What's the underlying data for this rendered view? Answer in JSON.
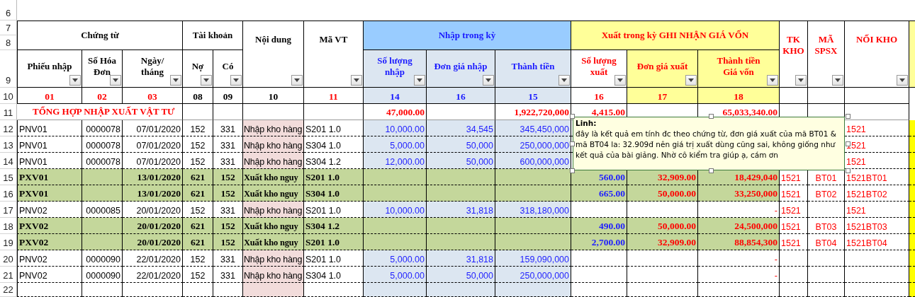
{
  "row_numbers": [
    "6",
    "7",
    "8",
    "9",
    "10",
    "11",
    "12",
    "13",
    "14",
    "15",
    "16",
    "17",
    "18",
    "19",
    "20",
    "21",
    "22"
  ],
  "header": [
    {
      "kind": "group",
      "label": "Chứng từ",
      "color": "#000000",
      "columns": [
        {
          "label": "Phiếu nhập",
          "color": "#000000",
          "filter_button": true,
          "code": {
            "text": "01",
            "color": "#ff0000"
          }
        },
        {
          "label": "Số  Hóa\nĐơn",
          "color": "#000000",
          "filter_button": true,
          "code": {
            "text": "02",
            "color": "#ff0000"
          }
        },
        {
          "label": "Ngày/\ntháng",
          "color": "#000000",
          "filter_button": true,
          "code": {
            "text": "03",
            "color": "#ff0000"
          }
        }
      ]
    },
    {
      "kind": "group",
      "label": "Tài khoản",
      "color": "#000000",
      "columns": [
        {
          "label": "Nợ",
          "color": "#000000",
          "filter_button": true,
          "code": {
            "text": "08",
            "color": "#000000"
          }
        },
        {
          "label": "Có",
          "color": "#000000",
          "filter_button": true,
          "code": {
            "text": "09",
            "color": "#000000"
          }
        }
      ]
    },
    {
      "kind": "single",
      "label": "Nội dung",
      "color": "#000000",
      "filter_button": true,
      "code": {
        "text": "10",
        "color": "#000000"
      }
    },
    {
      "kind": "single",
      "label": "Mã VT",
      "color": "#000000",
      "filter_button": true,
      "code": {
        "text": "11",
        "color": "#ff0000"
      }
    },
    {
      "kind": "inflow",
      "label": "Nhập trong kỳ",
      "color": "#1a1aff",
      "columns": [
        {
          "label": "Số lượng\nnhập",
          "color": "#1a1aff",
          "filter_button": true,
          "code": {
            "text": "14",
            "color": "#1a1aff"
          }
        },
        {
          "label": "Đơn giá nhập",
          "color": "#1a1aff",
          "filter_button": true,
          "code": {
            "text": "16",
            "color": "#1a1aff"
          }
        },
        {
          "label": "Thành tiền",
          "color": "#1a1aff",
          "filter_button": true,
          "code": {
            "text": "15",
            "color": "#1a1aff"
          }
        }
      ]
    },
    {
      "kind": "outflow",
      "label": "Xuất trong kỳ GHI NHẬN GIÁ VỐN",
      "color": "#ff0000",
      "columns": [
        {
          "label": "Số lượng\nxuất",
          "color": "#ff0000",
          "filter_button": true,
          "code": {
            "text": "16",
            "color": "#ff0000"
          }
        },
        {
          "label": "Đơn giá xuất",
          "color": "#ff0000",
          "filter_button": true,
          "code": {
            "text": "17",
            "color": "#ff0000"
          }
        },
        {
          "label": "Thành tiền\nGiá vốn",
          "color": "#ff0000",
          "filter_button": true,
          "code": {
            "text": "18",
            "color": "#ff0000"
          }
        }
      ]
    },
    {
      "kind": "single",
      "label": "TK\nKHO",
      "color": "#ff0000",
      "filter_button": true
    },
    {
      "kind": "single",
      "label": "MÃ\nSPSX",
      "color": "#ff0000",
      "filter_button": true
    },
    {
      "kind": "single",
      "label": "NỐI KHO",
      "color": "#ff0000",
      "filter_button": true
    }
  ],
  "rows": [
    {
      "kind": "total",
      "title": "TỔNG HỢP NHẬP XUẤT VẬT TƯ",
      "cells": {
        "sl_nhap": "47,000.00",
        "tt_nhap": "1,922,720,000",
        "sl_xuat": "4,415.00",
        "tt_xuat": "65,033,340.00"
      }
    },
    {
      "kind": "entry",
      "cells": {
        "phieu": "PNV01",
        "so_hd": "0000078",
        "ngay": "07/01/2020",
        "no": "152",
        "co": "331",
        "noi_dung": "Nhập kho hàng",
        "ma_vt": "S201 1.0",
        "sl_nhap": "10,000.00",
        "dg_nhap": "34,545",
        "tt_nhap": "345,450,000",
        "noi_kho": "1521"
      }
    },
    {
      "kind": "entry",
      "cells": {
        "phieu": "PNV01",
        "so_hd": "0000078",
        "ngay": "07/01/2020",
        "no": "152",
        "co": "331",
        "noi_dung": "Nhập kho hàng",
        "ma_vt": "S304 1.0",
        "sl_nhap": "5,000.00",
        "dg_nhap": "50,000",
        "tt_nhap": "250,000,000",
        "noi_kho": "1521"
      }
    },
    {
      "kind": "entry",
      "cells": {
        "phieu": "PNV01",
        "so_hd": "0000078",
        "ngay": "07/01/2020",
        "no": "152",
        "co": "331",
        "noi_dung": "Nhập kho hàng",
        "ma_vt": "S304 1.2",
        "sl_nhap": "12,000.00",
        "dg_nhap": "50,000",
        "tt_nhap": "600,000,000",
        "noi_kho": "1521"
      }
    },
    {
      "kind": "issue",
      "cells": {
        "phieu": "PXV01",
        "ngay": "13/01/2020",
        "no": "621",
        "co": "152",
        "noi_dung": "Xuất kho nguy",
        "ma_vt": "S201 1.0",
        "sl_xuat": "560.00",
        "dg_xuat": "32,909.00",
        "tt_xuat": "18,429,040",
        "tk_kho": "1521",
        "ma_spsx": "BT01",
        "noi_kho": "1521BT01"
      }
    },
    {
      "kind": "issue",
      "cells": {
        "phieu": "PXV01",
        "ngay": "13/01/2020",
        "no": "621",
        "co": "152",
        "noi_dung": "Xuất kho nguy",
        "ma_vt": "S304 1.0",
        "sl_xuat": "665.00",
        "dg_xuat": "50,000.00",
        "tt_xuat": "33,250,000",
        "tk_kho": "1521",
        "ma_spsx": "BT02",
        "noi_kho": "1521BT02"
      }
    },
    {
      "kind": "entry",
      "cells": {
        "phieu": "PNV02",
        "so_hd": "0000085",
        "ngay": "20/01/2020",
        "no": "152",
        "co": "331",
        "noi_dung": "Nhập kho hàng",
        "ma_vt": "S201 1.0",
        "sl_nhap": "10,000.00",
        "dg_nhap": "31,818",
        "tt_nhap": "318,180,000",
        "tt_xuat": "-",
        "tk_kho": "1521",
        "noi_kho": "1521"
      }
    },
    {
      "kind": "issue",
      "cells": {
        "phieu": "PXV02",
        "ngay": "20/01/2020",
        "no": "621",
        "co": "152",
        "noi_dung": "Xuất kho nguy",
        "ma_vt": "S304 1.2",
        "sl_xuat": "490.00",
        "dg_xuat": "50,000.00",
        "tt_xuat": "24,500,000",
        "tk_kho": "1521",
        "ma_spsx": "BT03",
        "noi_kho": "1521BT03"
      }
    },
    {
      "kind": "issue",
      "cells": {
        "phieu": "PXV02",
        "ngay": "20/01/2020",
        "no": "621",
        "co": "152",
        "noi_dung": "Xuất kho nguy",
        "ma_vt": "S201 1.0",
        "sl_xuat": "2,700.00",
        "dg_xuat": "32,909.00",
        "tt_xuat": "88,854,300",
        "tk_kho": "1521",
        "ma_spsx": "BT04",
        "noi_kho": "1521BT04"
      }
    },
    {
      "kind": "entry",
      "cells": {
        "phieu": "PNV02",
        "so_hd": "0000090",
        "ngay": "22/01/2020",
        "no": "152",
        "co": "331",
        "noi_dung": "Nhập kho hàng",
        "ma_vt": "S201 1.0",
        "sl_nhap": "5,000.00",
        "dg_nhap": "31,818",
        "tt_nhap": "159,090,000",
        "tt_xuat": "-"
      }
    },
    {
      "kind": "entry",
      "cells": {
        "phieu": "PNV02",
        "so_hd": "0000090",
        "ngay": "22/01/2020",
        "no": "152",
        "co": "331",
        "noi_dung": "Nhập kho hàng",
        "ma_vt": "S304 1.0",
        "sl_nhap": "5,000.00",
        "dg_nhap": "50,000",
        "tt_nhap": "250,000,000",
        "tt_xuat": "-"
      }
    },
    {
      "kind": "entry"
    }
  ],
  "comment": {
    "author": "Linh:",
    "text": "đây là kết quả em tính đc theo chứng từ, đơn giá xuất của mã BT01 & mã BT04 la: 32.909đ nên giá trị xuất dùng cũng sai, không giống như kết quả của bài giảng. Nhờ cô kiểm tra giúp ạ, cám ơn"
  }
}
